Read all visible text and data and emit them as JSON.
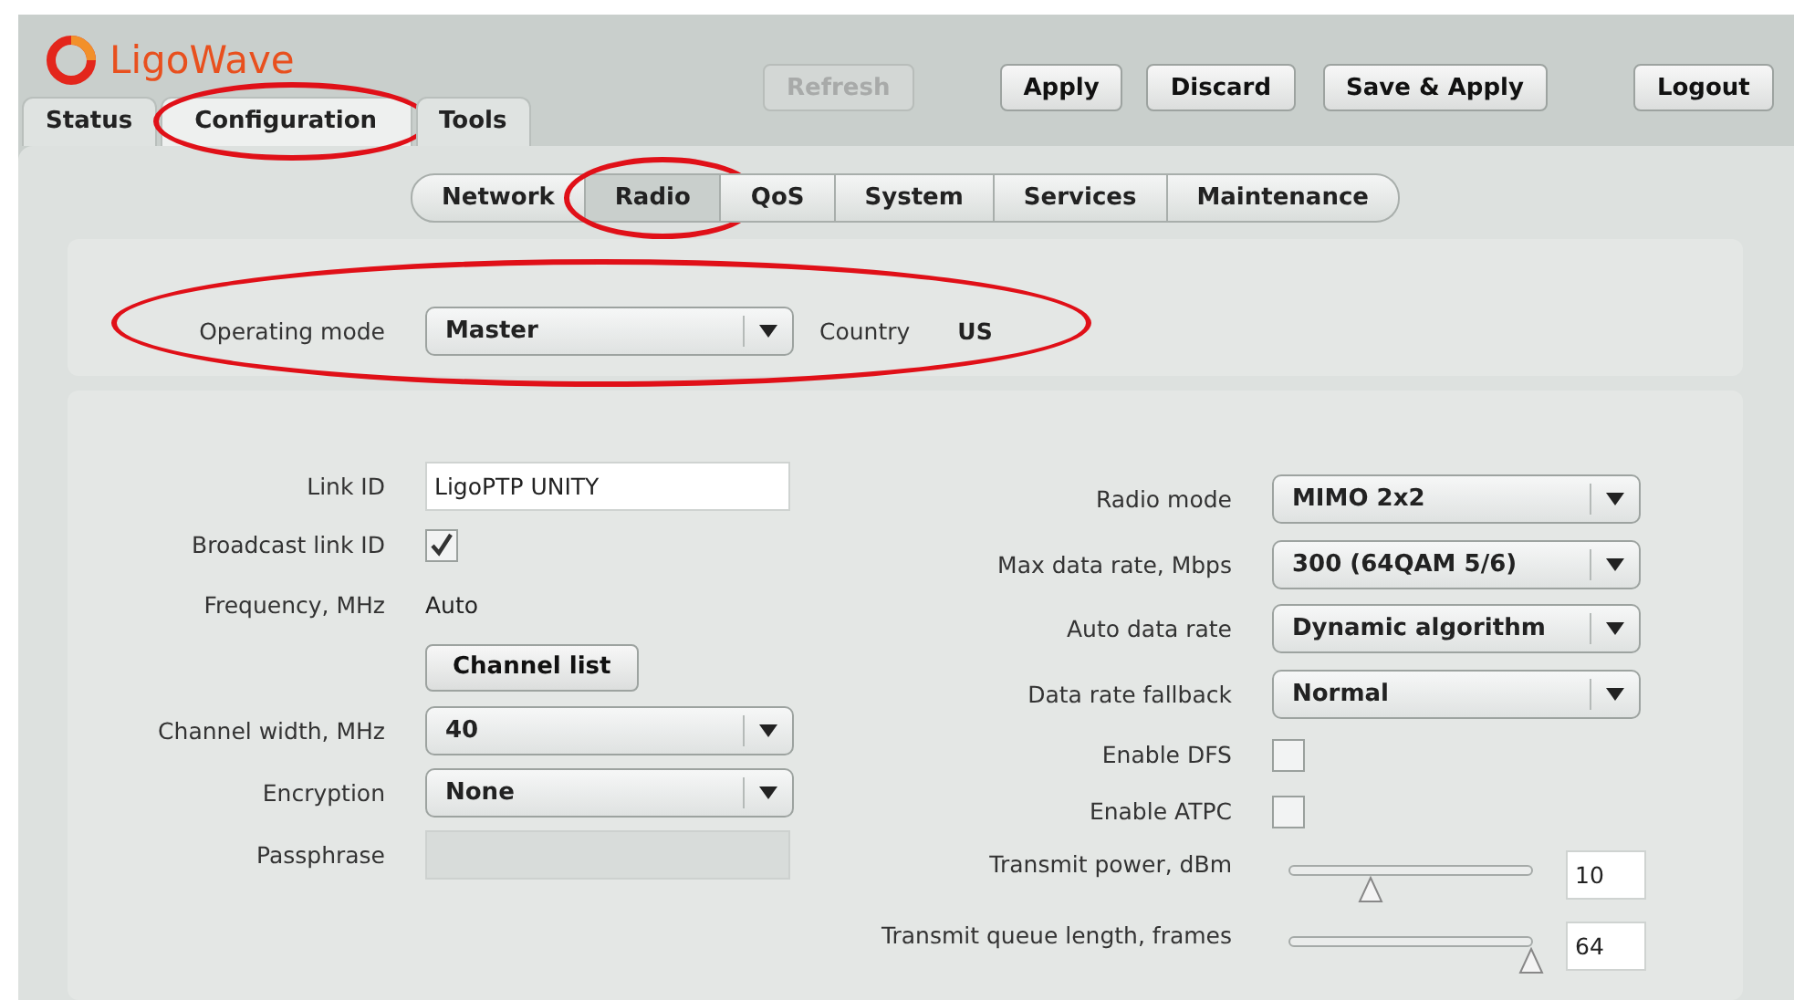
{
  "logo": {
    "text": "LigoWave"
  },
  "toolbar": [
    {
      "label": "Refresh",
      "disabled": true
    },
    {
      "label": "Apply",
      "disabled": false
    },
    {
      "label": "Discard",
      "disabled": false
    },
    {
      "label": "Save & Apply",
      "disabled": false
    },
    {
      "label": "Logout",
      "disabled": false
    }
  ],
  "main_tabs": [
    {
      "label": "Status",
      "selected": false,
      "highlighted": false
    },
    {
      "label": "Configuration",
      "selected": true,
      "highlighted": true
    },
    {
      "label": "Tools",
      "selected": false,
      "highlighted": false
    }
  ],
  "sub_tabs": [
    {
      "label": "Network",
      "selected": false,
      "highlighted": false
    },
    {
      "label": "Radio",
      "selected": true,
      "highlighted": true
    },
    {
      "label": "QoS",
      "selected": false,
      "highlighted": false
    },
    {
      "label": "System",
      "selected": false,
      "highlighted": false
    },
    {
      "label": "Services",
      "selected": false,
      "highlighted": false
    },
    {
      "label": "Maintenance",
      "selected": false,
      "highlighted": false
    }
  ],
  "operating_mode": {
    "label": "Operating mode",
    "value": "Master",
    "highlighted": true,
    "country_label": "Country",
    "country": "US"
  },
  "left_fields": [
    {
      "kind": "text",
      "label": "Link ID",
      "value": "LigoPTP UNITY",
      "disabled": false
    },
    {
      "kind": "checkbox",
      "label": "Broadcast link ID",
      "checked": true
    },
    {
      "kind": "readonly",
      "label": "Frequency, MHz",
      "value": "Auto"
    },
    {
      "kind": "button",
      "label": "Channel list"
    },
    {
      "kind": "select",
      "label": "Channel width, MHz",
      "value": "40"
    },
    {
      "kind": "select",
      "label": "Encryption",
      "value": "None"
    },
    {
      "kind": "text",
      "label": "Passphrase",
      "disabled": true
    }
  ],
  "right_fields": [
    {
      "kind": "select",
      "label": "Radio mode",
      "value": "MIMO 2x2"
    },
    {
      "kind": "select",
      "label": "Max data rate, Mbps",
      "value": "300 (64QAM 5/6)"
    },
    {
      "kind": "select",
      "label": "Auto data rate",
      "value": "Dynamic algorithm"
    },
    {
      "kind": "select",
      "label": "Data rate fallback",
      "value": "Normal"
    },
    {
      "kind": "checkbox",
      "label": "Enable DFS",
      "checked": false
    },
    {
      "kind": "checkbox",
      "label": "Enable ATPC",
      "checked": false
    },
    {
      "kind": "slider",
      "label": "Transmit power, dBm",
      "level": 0.33,
      "value": "10"
    },
    {
      "kind": "slider",
      "label": "Transmit queue length, frames",
      "level": 1,
      "value": "64"
    }
  ]
}
